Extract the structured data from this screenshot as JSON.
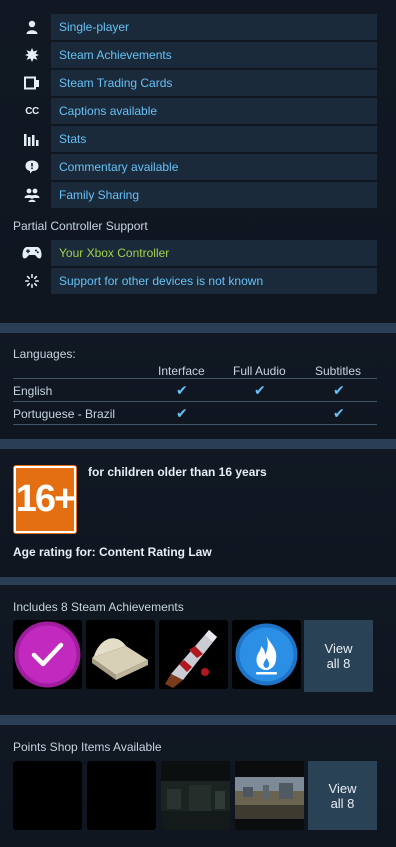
{
  "features": [
    {
      "icon": "single-player-icon",
      "label": "Single-player"
    },
    {
      "icon": "achievements-icon",
      "label": "Steam Achievements"
    },
    {
      "icon": "trading-cards-icon",
      "label": "Steam Trading Cards"
    },
    {
      "icon": "captions-icon",
      "label": "Captions available",
      "glyph": "CC"
    },
    {
      "icon": "stats-icon",
      "label": "Stats"
    },
    {
      "icon": "commentary-icon",
      "label": "Commentary available"
    },
    {
      "icon": "family-sharing-icon",
      "label": "Family Sharing"
    }
  ],
  "controller": {
    "heading": "Partial Controller Support",
    "items": [
      {
        "icon": "gamepad-icon",
        "label": "Your Xbox Controller"
      },
      {
        "icon": "loading-icon",
        "label": "Support for other devices is not known"
      }
    ]
  },
  "languages": {
    "title": "Languages:",
    "columns": [
      "Interface",
      "Full Audio",
      "Subtitles"
    ],
    "rows": [
      {
        "name": "English",
        "interface": "✔",
        "audio": "✔",
        "subtitles": "✔"
      },
      {
        "name": "Portuguese - Brazil",
        "interface": "✔",
        "audio": "",
        "subtitles": "✔"
      }
    ]
  },
  "age_rating": {
    "badge": "16+",
    "description": "for children older than 16 years",
    "for_text": "Age rating for: Content Rating Law"
  },
  "achievements": {
    "heading": "Includes 8 Steam Achievements",
    "view_all": {
      "line1": "View",
      "line2": "all 8"
    }
  },
  "points_shop": {
    "heading": "Points Shop Items Available",
    "view_all": {
      "line1": "View",
      "line2": "all 8"
    }
  }
}
